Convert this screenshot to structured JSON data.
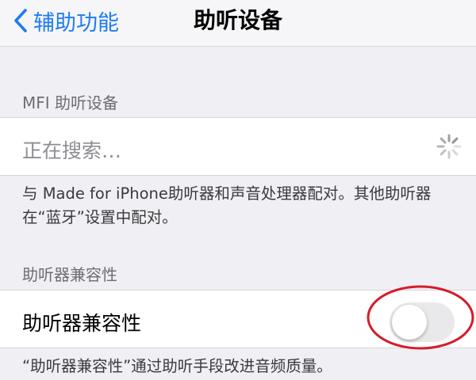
{
  "nav": {
    "back_label": "辅助功能",
    "title": "助听设备"
  },
  "mfi": {
    "header": "MFI 助听设备",
    "searching_text": "正在搜索…",
    "footer_line1": "与 Made for iPhone助听器和声音处理器配对。其他助听器",
    "footer_line2": "在“蓝牙”设置中配对。"
  },
  "compat": {
    "header": "助听器兼容性",
    "toggle_label": "助听器兼容性",
    "toggle_on": false,
    "footer": "“助听器兼容性”通过助听手段改进音频质量。"
  },
  "colors": {
    "accent": "#1f7cf3",
    "annotation": "#d61c2a"
  },
  "icons": {
    "back": "chevron-left-icon",
    "loading": "activity-spinner-icon"
  }
}
